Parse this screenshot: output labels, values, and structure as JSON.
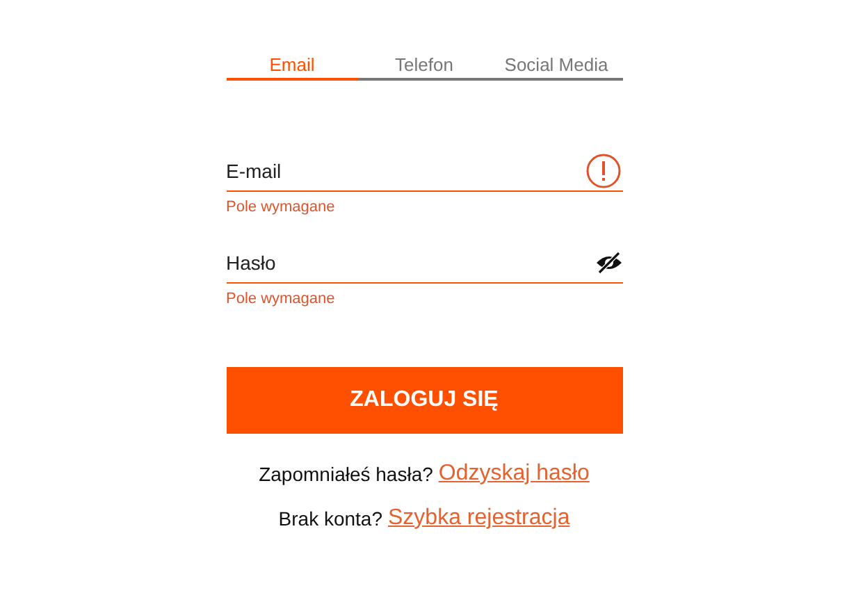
{
  "tabs": [
    {
      "label": "Email",
      "selected": true
    },
    {
      "label": "Telefon",
      "selected": false
    },
    {
      "label": "Social Media",
      "selected": false
    }
  ],
  "fields": [
    {
      "kind": "email",
      "label": "E-mail",
      "error": "Pole wymagane"
    },
    {
      "kind": "password",
      "label": "Hasło",
      "error": "Pole wymagane"
    }
  ],
  "submit": "ZALOGUJ SIĘ",
  "links": [
    {
      "prompt": "Zapomniałeś hasła?",
      "link": "Odzyskaj hasło"
    },
    {
      "prompt": "Brak konta?",
      "link": "Szybka rejestracja"
    }
  ]
}
